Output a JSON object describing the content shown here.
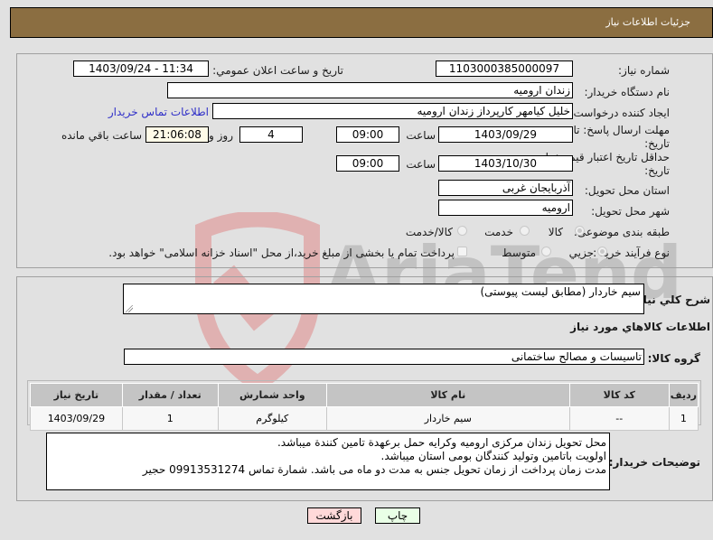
{
  "header": {
    "title": "جزئیات اطلاعات نیاز"
  },
  "form": {
    "need_number": {
      "label": "شماره نیاز:",
      "value": "1103000385000097"
    },
    "announce": {
      "label": "تاریخ و ساعت اعلان عمومي:",
      "value": "1403/09/24 - 11:34"
    },
    "buyer_org": {
      "label": "نام دستگاه خریدار:",
      "value": "زندان ارومیه"
    },
    "requester": {
      "label": "ایجاد کننده درخواست:",
      "value": "خلیل کیامهر کارپرداز زندان ارومیه"
    },
    "buyer_contact_link": "اطلاعات تماس خریدار",
    "response_deadline": {
      "label_line1": "مهلت ارسال پاسخ: تا",
      "label_line2": "تاریخ:",
      "date": "1403/09/29",
      "time_label": "ساعت",
      "time": "09:00",
      "days": "4",
      "days_label": "روز و",
      "remaining": "21:06:08",
      "remaining_label": "ساعت باقي مانده"
    },
    "price_validity": {
      "label_line1": "حداقل تاریخ اعتبار قیمت: تا",
      "label_line2": "تاریخ:",
      "date": "1403/10/30",
      "time_label": "ساعت",
      "time": "09:00"
    },
    "province": {
      "label": "استان محل تحویل:",
      "value": "آذربایجان غربی"
    },
    "city": {
      "label": "شهر محل تحویل:",
      "value": "ارومیه"
    },
    "category": {
      "label": "طبقه بندی موضوعی:",
      "options": [
        {
          "label": "کالا",
          "selected": true
        },
        {
          "label": "خدمت",
          "selected": false
        },
        {
          "label": "کالا/خدمت",
          "selected": false
        }
      ]
    },
    "purchase_type": {
      "label": "نوع فرآیند خرید :",
      "options": [
        {
          "label": "جزیي",
          "selected": true
        },
        {
          "label": "متوسط",
          "selected": false
        }
      ],
      "treasury_checkbox": {
        "label": "پرداخت تمام یا بخشی از مبلغ خرید،از محل \"اسناد خزانه اسلامی\" خواهد بود.",
        "checked": false
      }
    }
  },
  "details": {
    "description": {
      "label": "شرح کلي نیاز:",
      "value": "سیم خاردار (مطابق لیست پیوستی)"
    },
    "goods_section_title": "اطلاعات کالاهاي مورد نیاز",
    "goods_group": {
      "label": "گروه کالا:",
      "value": "تاسیسات و مصالح ساختمانی"
    },
    "table": {
      "headers": [
        "ردیف",
        "کد کالا",
        "نام کالا",
        "واحد شمارش",
        "تعداد / مقدار",
        "تاریخ نیاز"
      ],
      "rows": [
        [
          "1",
          "--",
          "سیم خاردار",
          "کیلوگرم",
          "1",
          "1403/09/29"
        ]
      ]
    },
    "buyer_notes": {
      "label": "توضیحات خریدار:",
      "lines": [
        "محل تحویل زندان مرکزی ارومیه وکرایه حمل برعهدة تامین کنندة میباشد.",
        "اولویت باتامین وتولید کنندگان بومی استان میباشد.",
        "مدت زمان پرداخت از زمان تحویل جنس به مدت دو ماه می باشد. شمارة تماس 09913531274 حجیر"
      ]
    }
  },
  "buttons": {
    "print": "چاپ",
    "back": "بازگشت"
  },
  "watermark": {
    "text": "AriaTender.neT"
  },
  "colors": {
    "header_bg": "#8b6e41",
    "back_bg": "#ffd9d9",
    "print_bg": "#e9ffe6",
    "link": "#2f2fc8"
  }
}
